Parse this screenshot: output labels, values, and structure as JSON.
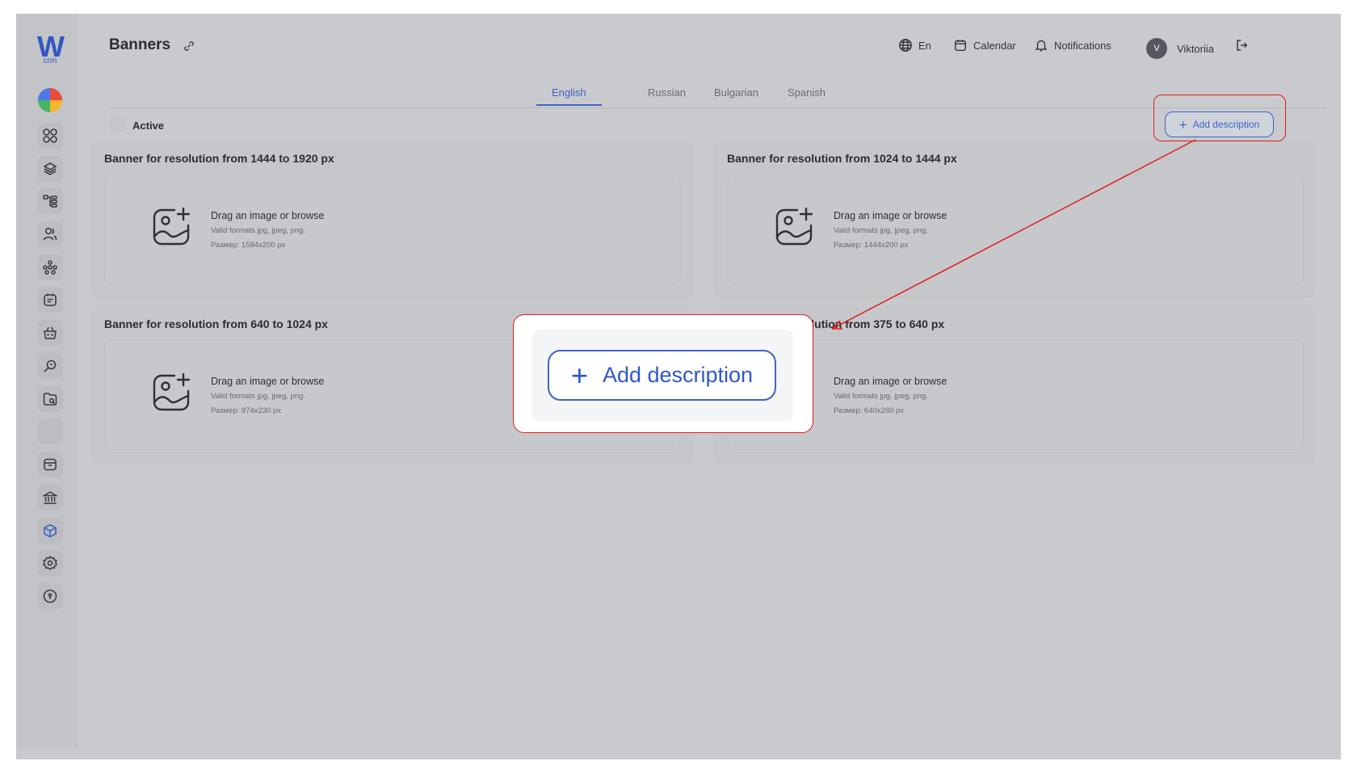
{
  "app": {
    "logo_letter": "W",
    "logo_sub": "crm"
  },
  "header": {
    "title": "Banners",
    "language": "En",
    "calendar": "Calendar",
    "notifications": "Notifications",
    "user_initial": "V",
    "user_name": "Viktoriia"
  },
  "tabs": [
    "English",
    "Russian",
    "Bulgarian",
    "Spanish"
  ],
  "active_tab": "English",
  "active_label": "Active",
  "add_description": "Add description",
  "plus": "+",
  "drop_title": "Drag an image or browse",
  "drop_formats": "Valid formats jpg, jpeg, png.",
  "banners": [
    {
      "title": "Banner for resolution from 1444 to 1920 px",
      "size": "Размер: 1584x200 px"
    },
    {
      "title": "Banner for resolution from 1024 to 1444 px",
      "size": "Размер: 1444x200 px"
    },
    {
      "title": "Banner for resolution from 640 to 1024 px",
      "size": "Размер: 974x230 px"
    },
    {
      "title": "Banner for resolution from 375 to 640 px",
      "size": "Размер: 640x260 px"
    }
  ],
  "sidebar_icons": [
    "dashboard-icon",
    "layers-icon",
    "hierarchy-icon",
    "users-icon",
    "network-icon",
    "notes-icon",
    "basket-icon",
    "search-key-icon",
    "folder-icon",
    "blank-icon",
    "archive-icon",
    "bank-icon",
    "cube-icon",
    "settings-icon",
    "shield-icon"
  ],
  "colors": {
    "accent": "#3d63c8",
    "callout": "#e01e1e"
  }
}
